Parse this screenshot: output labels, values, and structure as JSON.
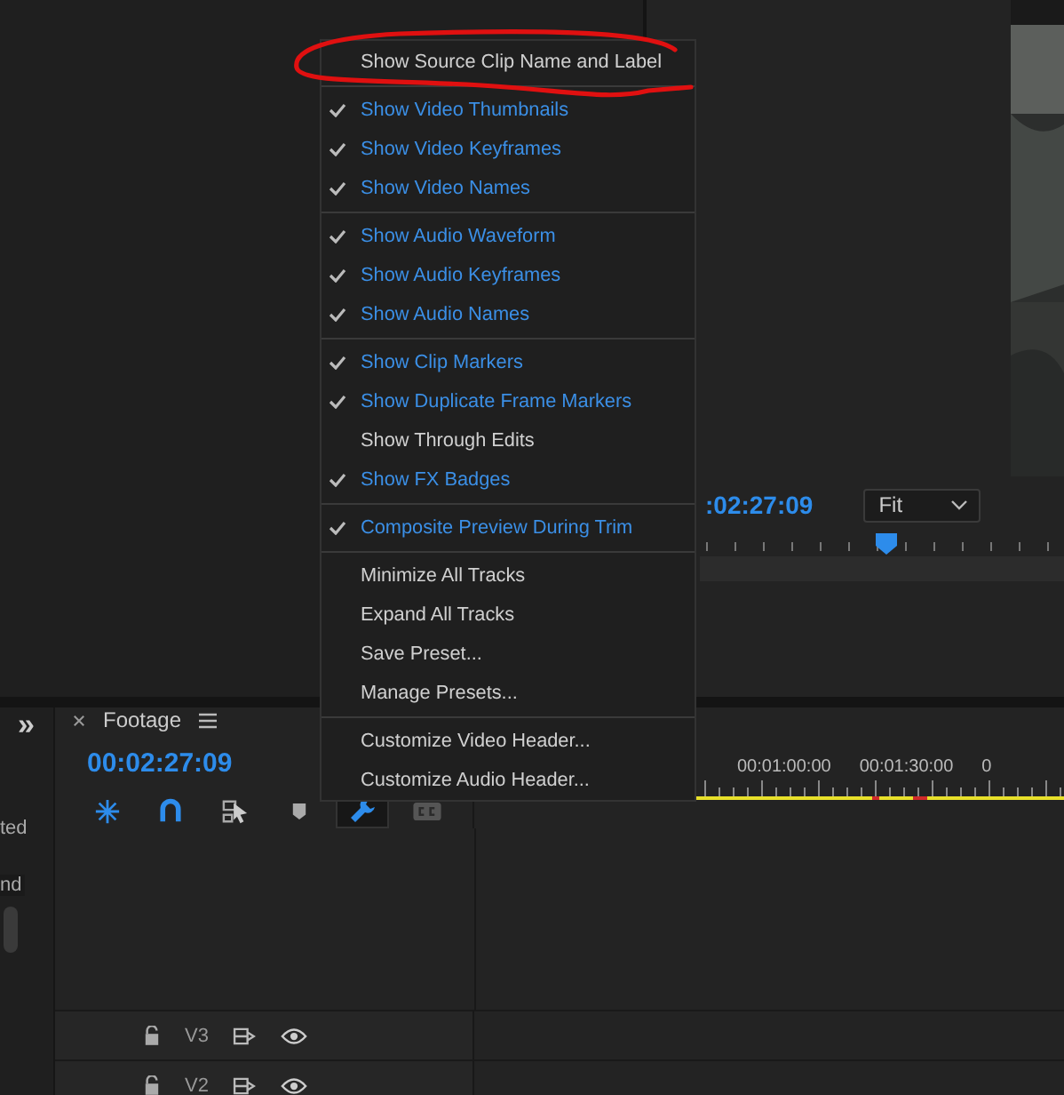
{
  "program_monitor": {
    "timecode": ":02:27:09",
    "zoom": "Fit"
  },
  "side_panel": {
    "expand": "»",
    "labels": [
      "ted",
      "nd"
    ]
  },
  "timeline": {
    "tab": "Footage",
    "timecode": "00:02:27:09",
    "tools": [
      {
        "kind": "nest",
        "selected": false
      },
      {
        "kind": "snap",
        "selected": false
      },
      {
        "kind": "linked",
        "selected": false
      },
      {
        "kind": "marker",
        "selected": false
      },
      {
        "kind": "settings",
        "selected": true
      },
      {
        "kind": "captions",
        "selected": false
      }
    ],
    "ruler_labels": [
      "00:01:00:00",
      "00:01:30:00",
      "0"
    ],
    "tracks": [
      {
        "name": "V3"
      },
      {
        "name": "V2"
      }
    ]
  },
  "context_menu": {
    "groups": [
      [
        {
          "label": "Show Source Clip Name and Label",
          "checked": false
        }
      ],
      [
        {
          "label": "Show Video Thumbnails",
          "checked": true
        },
        {
          "label": "Show Video Keyframes",
          "checked": true
        },
        {
          "label": "Show Video Names",
          "checked": true
        }
      ],
      [
        {
          "label": "Show Audio Waveform",
          "checked": true
        },
        {
          "label": "Show Audio Keyframes",
          "checked": true
        },
        {
          "label": "Show Audio Names",
          "checked": true
        }
      ],
      [
        {
          "label": "Show Clip Markers",
          "checked": true
        },
        {
          "label": "Show Duplicate Frame Markers",
          "checked": true
        },
        {
          "label": "Show Through Edits",
          "checked": false
        },
        {
          "label": "Show FX Badges",
          "checked": true
        }
      ],
      [
        {
          "label": "Composite Preview During Trim",
          "checked": true
        }
      ],
      [
        {
          "label": "Minimize All Tracks",
          "checked": false
        },
        {
          "label": "Expand All Tracks",
          "checked": false
        },
        {
          "label": "Save Preset...",
          "checked": false
        },
        {
          "label": "Manage Presets...",
          "checked": false
        }
      ],
      [
        {
          "label": "Customize Video Header...",
          "checked": false
        },
        {
          "label": "Customize Audio Header...",
          "checked": false
        }
      ]
    ]
  }
}
